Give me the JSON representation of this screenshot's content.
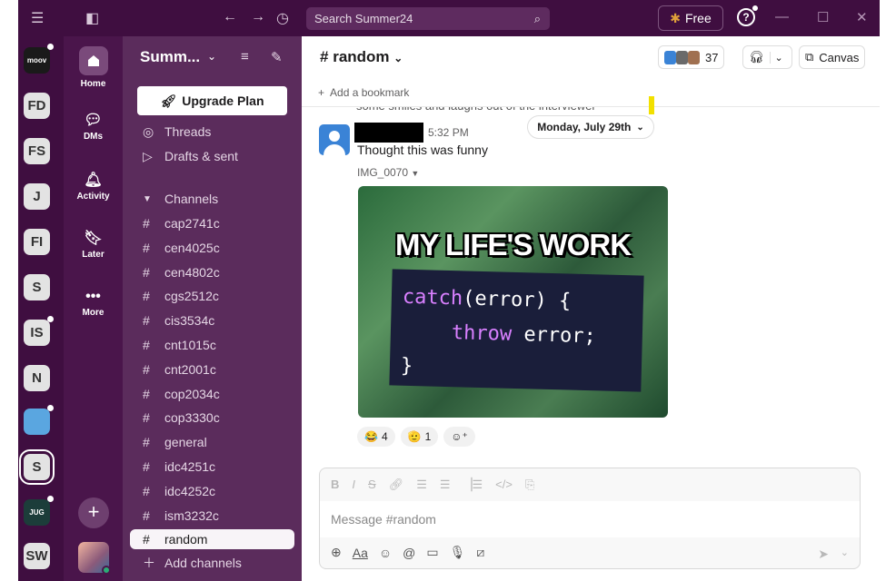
{
  "topbar": {
    "search_placeholder": "Search Summer24",
    "free_label": "Free",
    "help_label": "?"
  },
  "rail": {
    "workspaces": [
      {
        "label": "moov",
        "style": "dark",
        "dot": true
      },
      {
        "label": "FD",
        "style": "",
        "dot": false
      },
      {
        "label": "FS",
        "style": "",
        "dot": false
      },
      {
        "label": "J",
        "style": "",
        "dot": false
      },
      {
        "label": "FI",
        "style": "",
        "dot": false
      },
      {
        "label": "S",
        "style": "",
        "dot": false
      },
      {
        "label": "IS",
        "style": "",
        "dot": true
      },
      {
        "label": "N",
        "style": "",
        "dot": false
      },
      {
        "label": "",
        "style": "globe",
        "dot": true
      },
      {
        "label": "S",
        "style": "active",
        "dot": false
      },
      {
        "label": "JUG",
        "style": "jug",
        "dot": true
      },
      {
        "label": "SW",
        "style": "",
        "dot": false
      }
    ]
  },
  "nav": {
    "home": "Home",
    "dms": "DMs",
    "activity": "Activity",
    "later": "Later",
    "more": "More"
  },
  "sidebar": {
    "workspace_name": "Summ...",
    "upgrade_label": "Upgrade Plan",
    "threads": "Threads",
    "drafts": "Drafts & sent",
    "channels_header": "Channels",
    "channels": [
      "cap2741c",
      "cen4025c",
      "cen4802c",
      "cgs2512c",
      "cis3534c",
      "cnt1015c",
      "cnt2001c",
      "cop2034c",
      "cop3330c",
      "general",
      "idc4251c",
      "idc4252c",
      "ism3232c",
      "random"
    ],
    "selected_channel": "random",
    "add_channels": "Add channels"
  },
  "main": {
    "channel_title": "random",
    "member_count": "37",
    "canvas_label": "Canvas",
    "bookmark_label": "Add a bookmark",
    "cutoff_text": "some smiles and laughs out of the interviewer",
    "date_label": "Monday, July 29th",
    "message": {
      "time": "5:32 PM",
      "text": "Thought this was funny",
      "file_name": "IMG_0070",
      "meme_title": "MY LIFE'S WORK",
      "code_line1_kw": "catch",
      "code_line1_rest": "(error) {",
      "code_line2_kw": "throw",
      "code_line2_rest": " error;",
      "code_line3": "}"
    },
    "reactions": [
      {
        "emoji": "😂",
        "count": "4"
      },
      {
        "emoji": "🫡",
        "count": "1"
      }
    ],
    "composer_placeholder": "Message #random"
  },
  "colors": {
    "aubergine_dark": "#3f0e40",
    "aubergine": "#4a154b",
    "sidebar": "#5b2c5c"
  }
}
